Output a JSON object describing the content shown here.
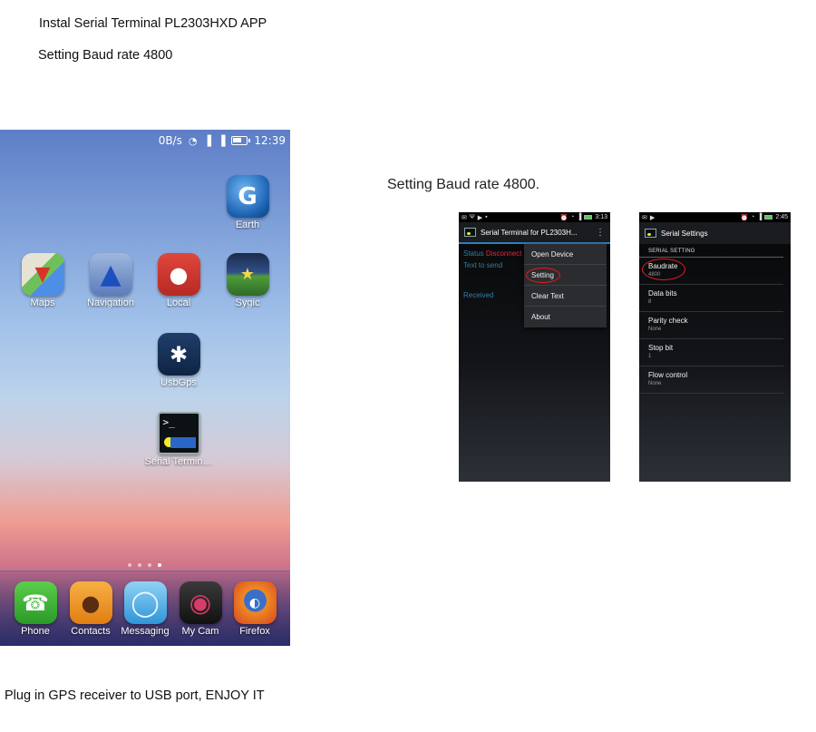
{
  "document": {
    "line1": "Instal  Serial Terminal PL2303HXD  APP",
    "line2": "Setting Baud rate 4800",
    "caption": "Setting Baud rate 4800.",
    "footer": "Plug in GPS receiver to USB port, ENJOY IT"
  },
  "phone": {
    "status": {
      "speed": "0B/s",
      "time": "12:39"
    },
    "apps": [
      {
        "label": "Earth",
        "icon": "google-earth-icon",
        "color": "#1a6fc9"
      },
      {
        "label": "Maps",
        "icon": "maps-icon",
        "color": "#6fbf5a"
      },
      {
        "label": "Navigation",
        "icon": "navigation-icon",
        "color": "#3f70c8"
      },
      {
        "label": "Local",
        "icon": "local-icon",
        "color": "#d33a32"
      },
      {
        "label": "Sygic",
        "icon": "sygic-icon",
        "color": "#3d8a3f"
      },
      {
        "label": "UsbGps",
        "icon": "usbgps-icon",
        "color": "#1e4d8c"
      },
      {
        "label": "Serial Termin…",
        "icon": "serial-terminal-icon",
        "color": "#203030"
      }
    ],
    "dock": [
      {
        "label": "Phone",
        "icon": "phone-icon",
        "color": "#3cae33"
      },
      {
        "label": "Contacts",
        "icon": "contacts-icon",
        "color": "#f09522"
      },
      {
        "label": "Messaging",
        "icon": "messaging-icon",
        "color": "#3aa6e0"
      },
      {
        "label": "My Cam",
        "icon": "camera-icon",
        "color": "#2a2a2a"
      },
      {
        "label": "Firefox",
        "icon": "firefox-icon",
        "color": "#e8662a"
      }
    ]
  },
  "screen1": {
    "status_time": "3:13",
    "title": "Serial Terminal for PL2303H...",
    "status_label": "Status",
    "status_value": "Disconnect",
    "text_to_send": "Text to send",
    "received": "Received",
    "menu": [
      "Open Device",
      "Setting",
      "Clear Text",
      "About"
    ]
  },
  "screen2": {
    "status_time": "2:45",
    "title": "Serial Settings",
    "section": "SERIAL SETTING",
    "prefs": [
      {
        "title": "Baudrate",
        "value": "4800"
      },
      {
        "title": "Data bits",
        "value": "8"
      },
      {
        "title": "Parity check",
        "value": "None"
      },
      {
        "title": "Stop bit",
        "value": "1"
      },
      {
        "title": "Flow control",
        "value": "None"
      }
    ]
  },
  "colors": {
    "highlight": "#e21b1b",
    "accent_blue": "#2e7fb8"
  }
}
